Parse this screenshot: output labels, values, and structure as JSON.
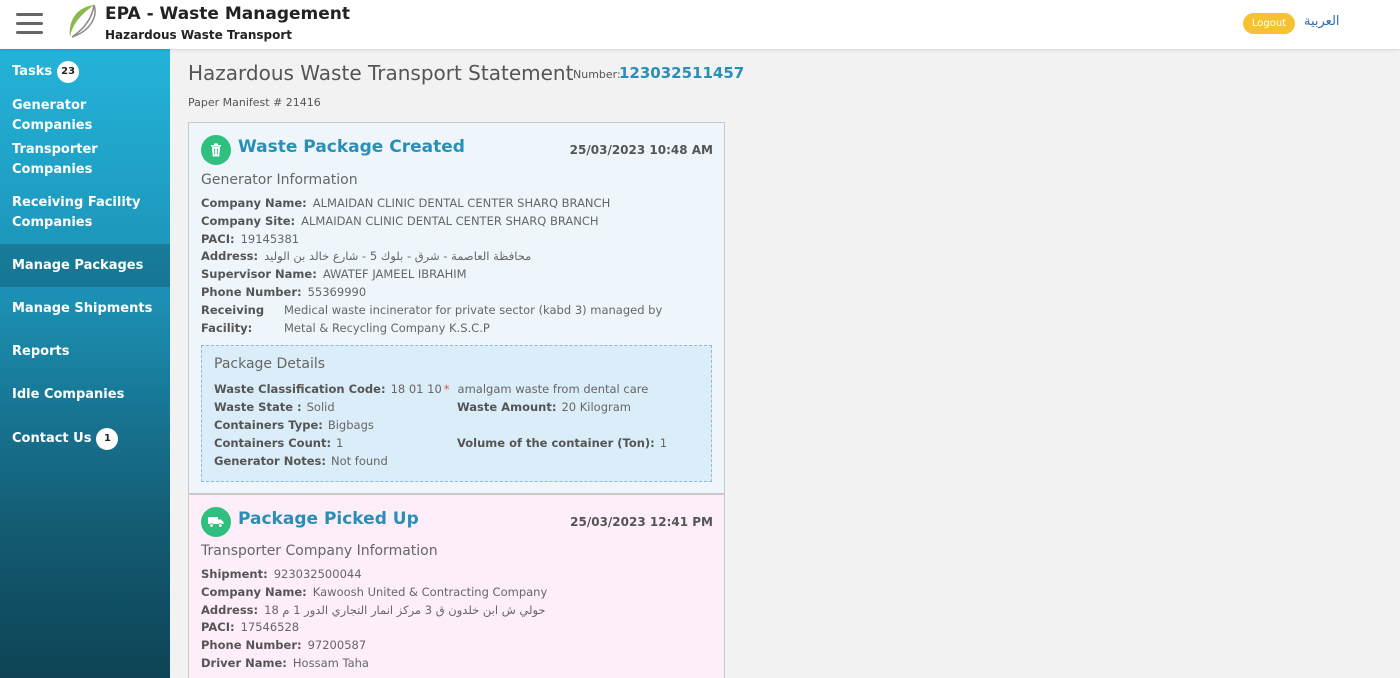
{
  "header": {
    "app_title": "EPA - Waste Management",
    "app_subtitle": "Hazardous Waste Transport",
    "logout_label": "Logout",
    "language_link": "العربية"
  },
  "sidebar": {
    "items": [
      {
        "label": "Tasks",
        "badge": "23"
      },
      {
        "label": "Generator Companies"
      },
      {
        "label": "Transporter Companies"
      },
      {
        "label": "Receiving Facility Companies"
      },
      {
        "label": "Manage Packages",
        "active": true
      },
      {
        "label": "Manage Shipments"
      },
      {
        "label": "Reports"
      },
      {
        "label": "Idle Companies"
      },
      {
        "label": "Contact Us",
        "badge": "1"
      }
    ]
  },
  "page": {
    "title": "Hazardous Waste Transport Statement",
    "number_label": "Number:",
    "number_value": "123032511457",
    "manifest": "Paper Manifest # 21416"
  },
  "card_created": {
    "title": "Waste Package Created",
    "date": "25/03/2023 10:48 AM",
    "icon": "trash-icon",
    "section_title": "Generator Information",
    "fields": [
      {
        "label": "Company Name:",
        "value": "ALMAIDAN CLINIC DENTAL CENTER SHARQ BRANCH"
      },
      {
        "label": "Company Site:",
        "value": "ALMAIDAN CLINIC DENTAL CENTER SHARQ BRANCH"
      },
      {
        "label": "PACI:",
        "value": "19145381"
      },
      {
        "label": "Address:",
        "value": "محافظة العاصمة - شرق - بلوك 5 - شارع خالد بن الوليد"
      },
      {
        "label": "Supervisor Name:",
        "value": "AWATEF JAMEEL IBRAHIM"
      },
      {
        "label": "Phone Number:",
        "value": "55369990"
      },
      {
        "label": "Receiving Facility:",
        "value": "Medical waste incinerator for private sector (kabd 3) managed by Metal & Recycling Company K.S.C.P"
      }
    ],
    "package": {
      "title": "Package Details",
      "classification_label": "Waste Classification Code:",
      "classification_code": "18 01 10",
      "classification_mark": "*",
      "classification_desc": "amalgam waste from dental care",
      "state_label": "Waste State :",
      "state_value": "Solid",
      "amount_label": "Waste Amount:",
      "amount_value": "20  Kilogram",
      "containers_type_label": "Containers Type:",
      "containers_type_value": "Bigbags",
      "containers_count_label": "Containers Count:",
      "containers_count_value": "1",
      "volume_label": "Volume of the container (Ton):",
      "volume_value": "1",
      "notes_label": "Generator Notes:",
      "notes_value": "Not found"
    }
  },
  "card_picked": {
    "title": "Package Picked Up",
    "date": "25/03/2023 12:41 PM",
    "icon": "truck-icon",
    "section_title": "Transporter Company Information",
    "fields": [
      {
        "label": "Shipment:",
        "value": "923032500044"
      },
      {
        "label": "Company Name:",
        "value": "Kawoosh United & Contracting Company"
      },
      {
        "label": "Address:",
        "value": "حولي ش ابن خلدون ق 3 مركز انمار التجاري الدور 1 م 18"
      },
      {
        "label": "PACI:",
        "value": "17546528"
      },
      {
        "label": "Phone Number:",
        "value": "97200587"
      },
      {
        "label": "Driver Name:",
        "value": "Hossam Taha"
      }
    ]
  },
  "colors": {
    "accent": "#2a8fb8",
    "logout": "#f5c232",
    "status_icon": "#2fbf7f",
    "sidebar_top": "#24b3d9",
    "sidebar_bottom": "#0e4355"
  }
}
